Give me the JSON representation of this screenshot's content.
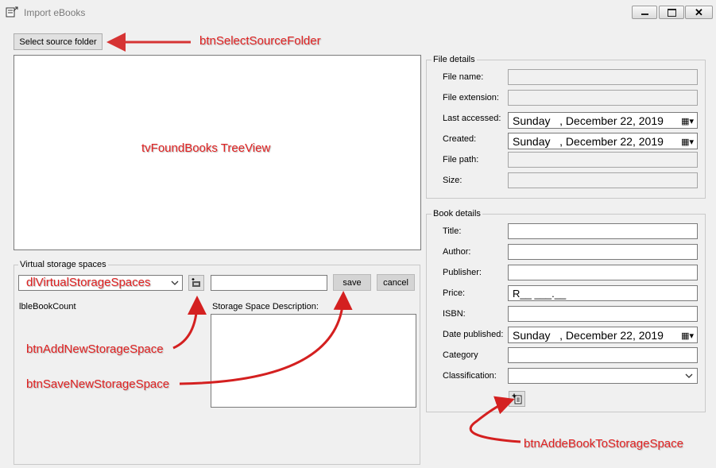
{
  "window": {
    "title": "Import eBooks",
    "icon": "ebook-import-icon",
    "controls": {
      "minimize": "minimize-icon",
      "maximize": "maximize-icon",
      "close": "close-icon"
    }
  },
  "source": {
    "select_button_label": "Select source folder",
    "tree_placeholder": "tvFoundBooks TreeView"
  },
  "virtual_storage": {
    "group_title": "Virtual storage spaces",
    "combo_text": "dlVirtualStorageSpaces",
    "book_count_label": "lbleBookCount",
    "new_space_value": "",
    "save_label": "save",
    "cancel_label": "cancel",
    "description_label": "Storage Space Description:",
    "description_value": ""
  },
  "file_details": {
    "group_title": "File details",
    "file_name_label": "File name:",
    "file_name_value": "",
    "file_extension_label": "File extension:",
    "file_extension_value": "",
    "last_accessed_label": "Last accessed:",
    "last_accessed_value": "Sunday   , December 22, 2019",
    "created_label": "Created:",
    "created_value": "Sunday   , December 22, 2019",
    "file_path_label": "File path:",
    "file_path_value": "",
    "size_label": "Size:",
    "size_value": ""
  },
  "book_details": {
    "group_title": "Book details",
    "title_label": "Title:",
    "title_value": "",
    "author_label": "Author:",
    "author_value": "",
    "publisher_label": "Publisher:",
    "publisher_value": "",
    "price_label": "Price:",
    "price_value": "R__ ___.__",
    "isbn_label": "ISBN:",
    "isbn_value": "",
    "date_published_label": "Date published:",
    "date_published_value": "Sunday   , December 22, 2019",
    "category_label": "Category",
    "category_value": "",
    "classification_label": "Classification:",
    "classification_value": ""
  },
  "annotations": {
    "select_folder": "btnSelectSourceFolder",
    "add_storage": "btnAddNewStorageSpace",
    "save_storage": "btnSaveNewStorageSpace",
    "add_book": "btnAddeBookToStorageSpace"
  },
  "colors": {
    "annotation": "#e02222",
    "window_bg": "#f0f0f0"
  }
}
